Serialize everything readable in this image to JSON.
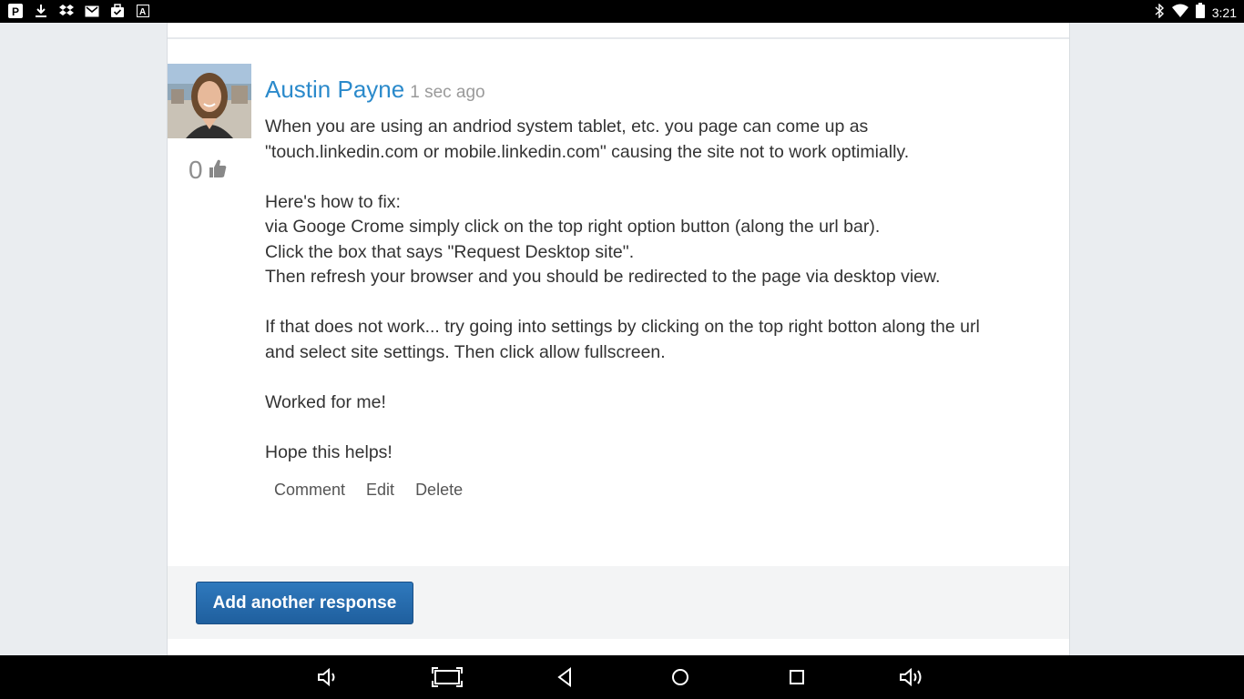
{
  "status_bar": {
    "time": "3:21",
    "left_icons": [
      "parking-app-icon",
      "download-icon",
      "dropbox-icon",
      "gmail-icon",
      "briefcase-check-icon",
      "a-app-icon"
    ],
    "right_icons": [
      "bluetooth-icon",
      "wifi-icon",
      "battery-icon"
    ]
  },
  "post": {
    "author": "Austin Payne",
    "time_ago": "1 sec ago",
    "like_count": "0",
    "paragraphs": [
      "When you are using an andriod system tablet, etc. you page can come up as\n\"touch.linkedin.com or mobile.linkedin.com\" causing the site not to work optimially.",
      "Here's how to fix:\nvia Googe Crome simply click on the top right option button (along the url bar).\nClick the box that says \"Request Desktop site\".\nThen refresh your browser and you should be redirected to the page via desktop view.",
      "If that does not work... try going into settings by clicking on the top right botton along the url\nand select site settings. Then click allow fullscreen.",
      "Worked for me!",
      "Hope this helps!"
    ],
    "actions": {
      "comment": "Comment",
      "edit": "Edit",
      "delete": "Delete"
    }
  },
  "footer": {
    "add_response": "Add another response"
  },
  "nav_bar": {
    "buttons": [
      "volume-down-icon",
      "screenshot-icon",
      "back-icon",
      "home-icon",
      "recents-icon",
      "volume-up-icon"
    ]
  },
  "colors": {
    "link": "#2b8acb",
    "button": "#2a6fb3"
  }
}
